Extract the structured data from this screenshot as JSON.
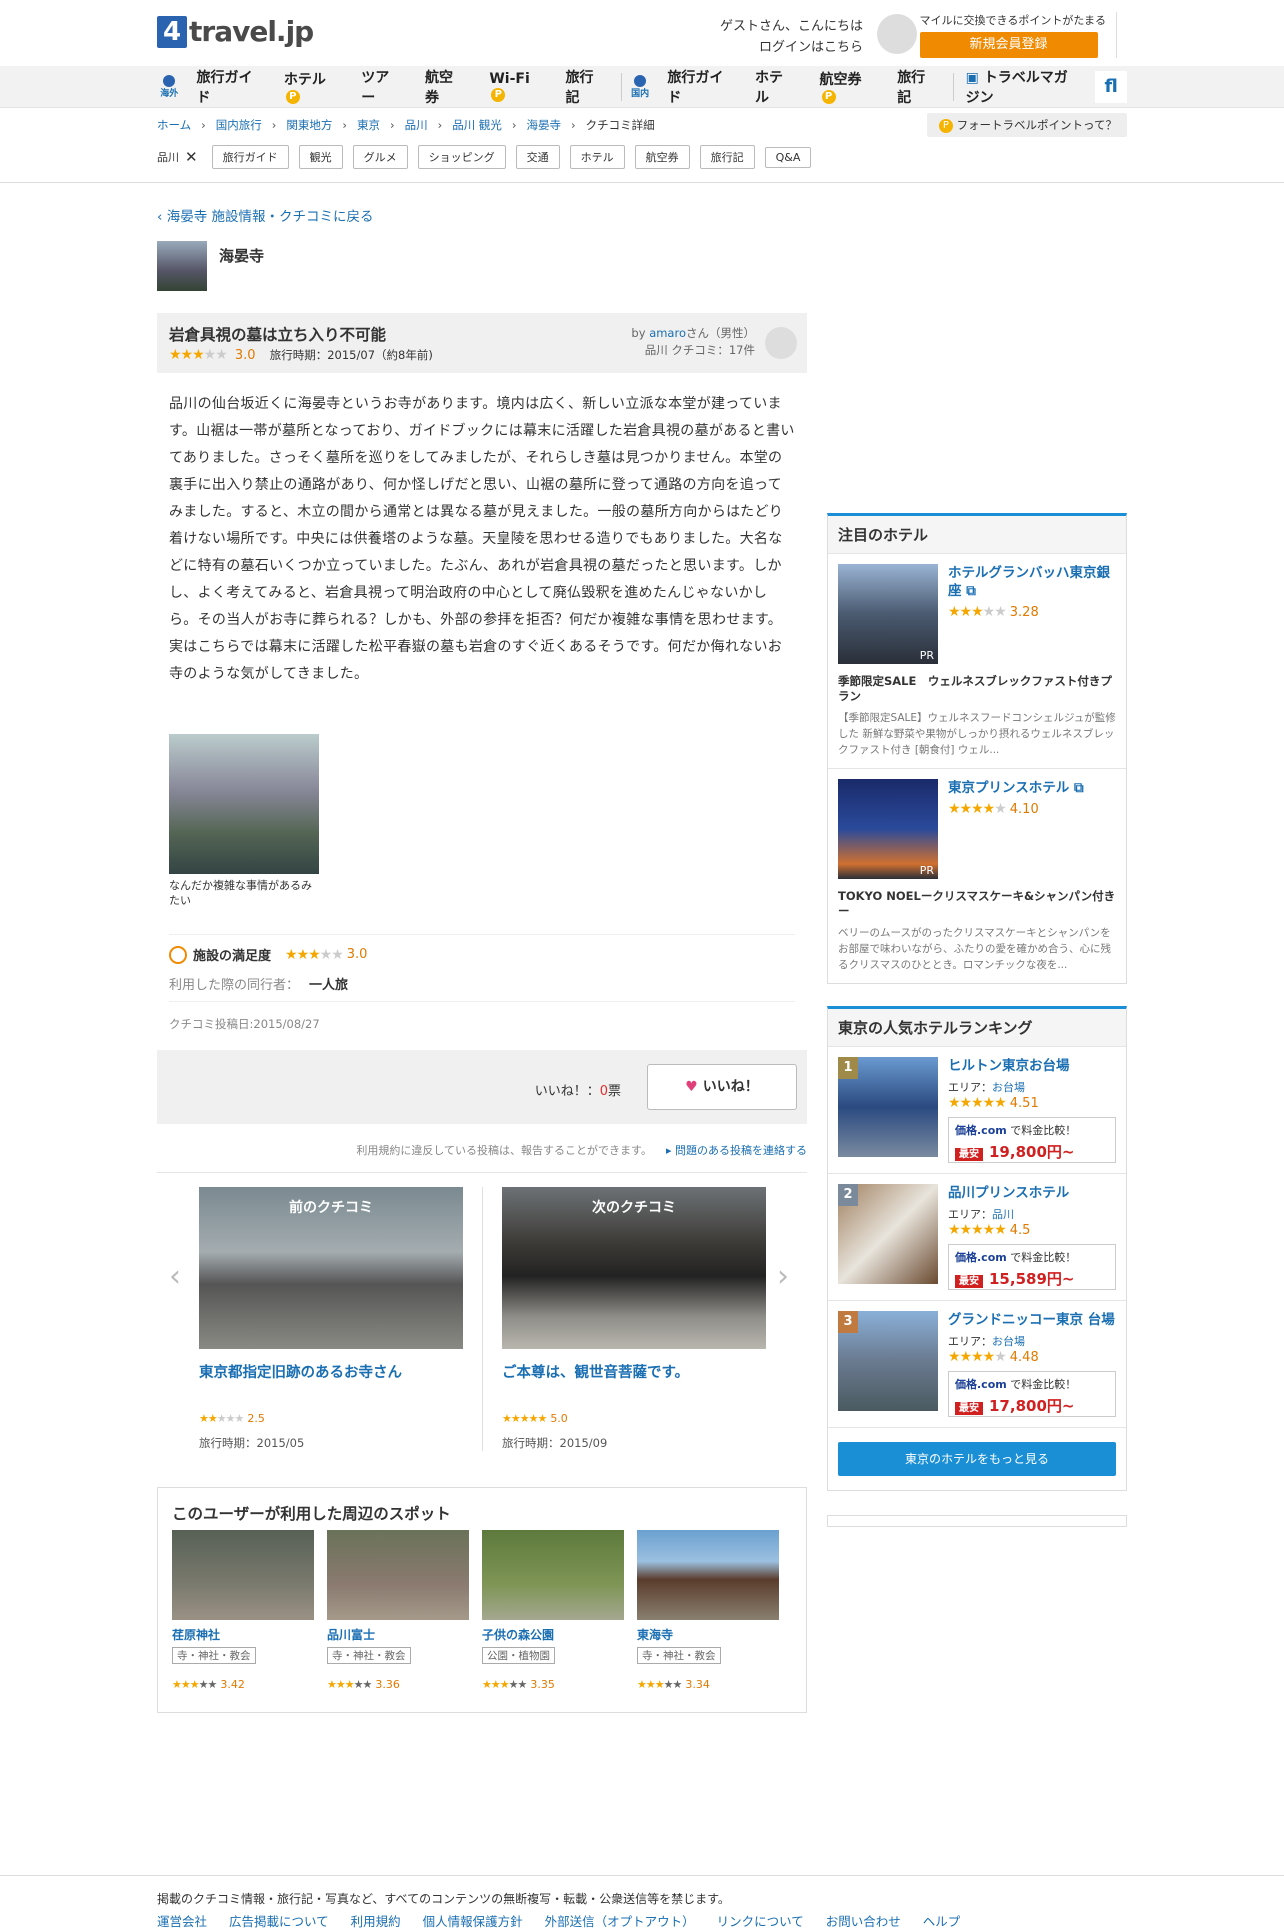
{
  "header": {
    "logo_num": "4",
    "logo_text": "travel.jp",
    "greet1": "ゲストさん、こんにちは",
    "greet2": "ログインはこちら",
    "reg_note": "マイルに交換できるポイントがたまる",
    "reg_btn": "新規会員登録"
  },
  "nav": {
    "overseas": "海外",
    "domestic": "国内",
    "items1": [
      "旅行ガイド",
      "ホテル",
      "ツアー",
      "航空券",
      "Wi-Fi",
      "旅行記"
    ],
    "items2": [
      "旅行ガイド",
      "ホテル",
      "航空券",
      "旅行記"
    ],
    "magazine": "トラベルマガジン",
    "search": "ﬂ",
    "coin": "P"
  },
  "breadcrumb": {
    "items": [
      "ホーム",
      "国内旅行",
      "関東地方",
      "東京",
      "品川",
      "品川 観光",
      "海晏寺"
    ],
    "current": "クチコミ詳細",
    "arrow": "›",
    "points": "フォートラベルポイントって？"
  },
  "cats": {
    "label": "品川",
    "x": "✕",
    "items": [
      "旅行ガイド",
      "観光",
      "グルメ",
      "ショッピング",
      "交通",
      "ホテル",
      "航空券",
      "旅行記",
      "Q&A"
    ]
  },
  "main": {
    "back": "海晏寺 施設情報・クチコミに戻る",
    "back_icon": "‹",
    "place": "海晏寺",
    "review": {
      "title": "岩倉具視の墓は立ち入り不可能",
      "stars": "★★★",
      "stars_off": "★★",
      "score": "3.0",
      "period": "旅行時期：2015/07（約8年前)",
      "by": "by",
      "user": "amaro",
      "user_suffix": "さん（男性）",
      "count": "品川 クチコミ：17件",
      "body": "品川の仙台坂近くに海晏寺というお寺があります。境内は広く、新しい立派な本堂が建っています。山裾は一帯が墓所となっており、ガイドブックには幕末に活躍した岩倉具視の墓があると書いてありました。さっそく墓所を巡りをしてみましたが、それらしき墓は見つかりません。本堂の裏手に出入り禁止の通路があり、何か怪しげだと思い、山裾の墓所に登って通路の方向を追ってみました。すると、木立の間から通常とは異なる墓が見えました。一般の墓所方向からはたどり着けない場所です。中央には供養塔のような墓。天皇陵を思わせる造りでもありました。大名などに特有の墓石いくつか立っていました。たぶん、あれが岩倉具視の墓だったと思います。しかし、よく考えてみると、岩倉具視って明治政府の中心として廃仏毀釈を進めたんじゃないかしら。その当人がお寺に葬られる？しかも、外部の参拝を拒否？何だか複雑な事情を思わせます。実はこちらでは幕末に活躍した松平春嶽の墓も岩倉のすぐ近くあるそうです。何だか侮れないお寺のような気がしてきました。",
      "caption": "なんだか複雑な事情があるみたい",
      "sat_label": "施設の満足度",
      "sat_score": "3.0",
      "comp_label": "利用した際の同行者：",
      "comp_value": "一人旅",
      "posted": "クチコミ投稿日:2015/08/27",
      "like_label": "いいね！：",
      "like_count": "0",
      "like_unit": "票",
      "like_btn": "いいね！",
      "heart": "♥",
      "report": "利用規約に違反している投稿は、報告することができます。",
      "report_link": "▸ 問題のある投稿を連絡する"
    },
    "prev": {
      "badge": "前のクチコミ",
      "title": "東京都指定旧跡のあるお寺さん",
      "stars": "★★",
      "stars_off": "★★★",
      "score": "2.5",
      "period": "旅行時期：2015/05"
    },
    "next": {
      "badge": "次のクチコミ",
      "title": "ご本尊は、観世音菩薩です。",
      "stars": "★★★★★",
      "stars_off": "",
      "score": "5.0",
      "period": "旅行時期：2015/09"
    },
    "arrow_l": "‹",
    "arrow_r": "›",
    "spots": {
      "title": "このユーザーが利用した周辺のスポット",
      "items": [
        {
          "name": "荏原神社",
          "genre": "寺・神社・教会",
          "stars": "★★★",
          "off": "★★",
          "score": "3.42"
        },
        {
          "name": "品川富士",
          "genre": "寺・神社・教会",
          "stars": "★★★",
          "off": "★★",
          "score": "3.36"
        },
        {
          "name": "子供の森公園",
          "genre": "公園・植物園",
          "stars": "★★★",
          "off": "★★",
          "score": "3.35"
        },
        {
          "name": "東海寺",
          "genre": "寺・神社・教会",
          "stars": "★★★",
          "off": "★★",
          "score": "3.34"
        }
      ]
    }
  },
  "side": {
    "hot_title": "注目のホテル",
    "hotels": [
      {
        "name": "ホテルグランバッハ東京銀座",
        "stars": "★★★",
        "off": "★★",
        "score": "3.28",
        "pr": "PR",
        "plan": "季節限定SALE　ウェルネスブレックファスト付きプラン",
        "desc": "【季節限定SALE】ウェルネスフードコンシェルジュが監修した 新鮮な野菜や果物がしっかり摂れるウェルネスブレックファスト付き [朝食付] ウェル..."
      },
      {
        "name": "東京プリンスホテル",
        "stars": "★★★★",
        "off": "★",
        "score": "4.10",
        "pr": "PR",
        "plan": "TOKYO NOELークリスマスケーキ&シャンパン付きー",
        "desc": "ベリーのムースがのったクリスマスケーキとシャンパンをお部屋で味わいながら、ふたりの愛を確かめ合う、心に残るクリスマスのひととき。ロマンチックな夜を..."
      }
    ],
    "rank_title": "東京の人気ホテルランキング",
    "area_label": "エリア：",
    "kakaku": "価格.com",
    "compare": "で料金比較！",
    "saiyasu": "最安",
    "ranks": [
      {
        "no": "1",
        "name": "ヒルトン東京お台場",
        "area": "お台場",
        "stars": "★★★★★",
        "off": "",
        "score": "4.51",
        "price": "19,800円~"
      },
      {
        "no": "2",
        "name": "品川プリンスホテル",
        "area": "品川",
        "stars": "★★★★★",
        "off": "",
        "score": "4.5",
        "price": "15,589円~"
      },
      {
        "no": "3",
        "name": "グランドニッコー東京 台場",
        "area": "お台場",
        "stars": "★★★★",
        "off": "★",
        "score": "4.48",
        "price": "17,800円~"
      }
    ],
    "more": "東京のホテルをもっと見る"
  },
  "footer": {
    "note": "掲載のクチコミ情報・旅行記・写真など、すべてのコンテンツの無断複写・転載・公衆送信等を禁じます。",
    "links": [
      "運営会社",
      "広告掲載について",
      "利用規約",
      "個人情報保護方針",
      "外部送信（オプトアウト）",
      "リンクについて",
      "お問い合わせ",
      "ヘルプ"
    ]
  }
}
